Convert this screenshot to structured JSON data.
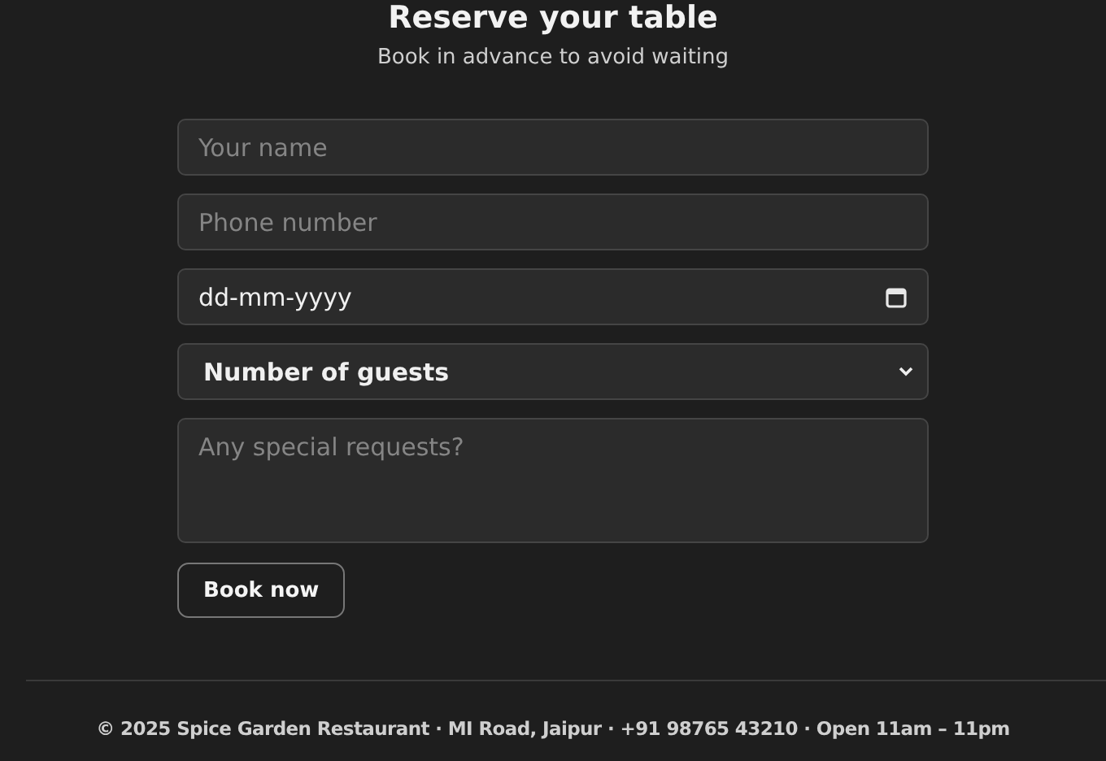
{
  "header": {
    "title": "Reserve your table",
    "subtitle": "Book in advance to avoid waiting"
  },
  "fields": [
    {
      "kind": "text",
      "placeholder": "Your name"
    },
    {
      "kind": "text",
      "placeholder": "Phone number"
    },
    {
      "kind": "date",
      "value": "dd-mm-yyyy"
    },
    {
      "kind": "select",
      "value": "Number of guests"
    },
    {
      "kind": "textarea",
      "placeholder": "Any special requests?"
    }
  ],
  "submit": "Book now",
  "footer": "© 2025 Spice Garden Restaurant · MI Road, Jaipur · +91 98765 43210 · Open 11am – 11pm"
}
